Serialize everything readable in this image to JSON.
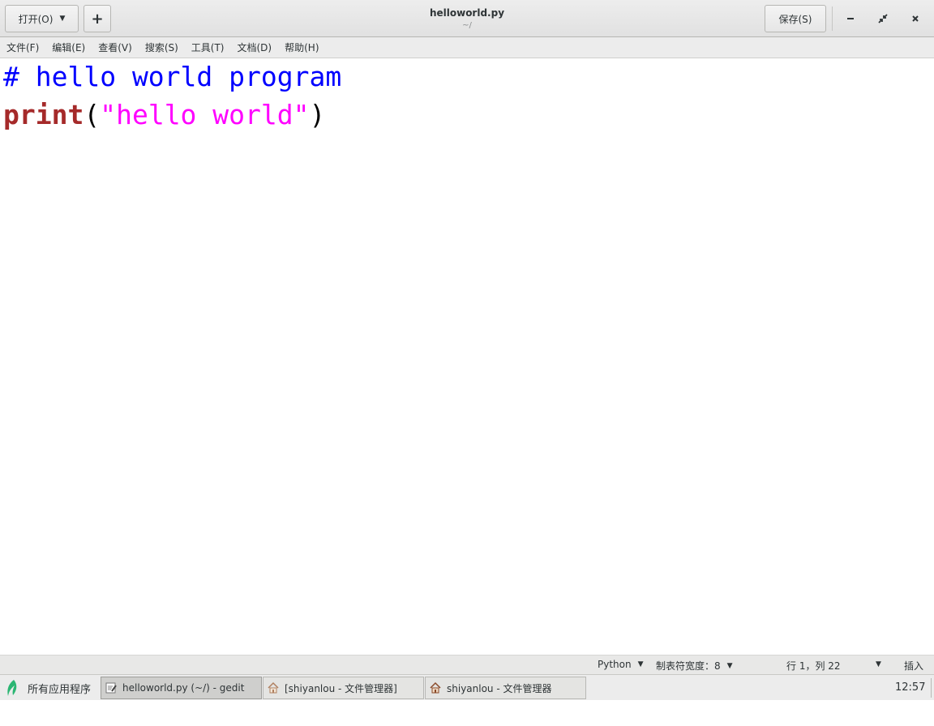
{
  "header": {
    "open_label": "打开(O)",
    "new_tab_symbol": "+",
    "title": "helloworld.py",
    "subtitle": "~/",
    "save_label": "保存(S)",
    "window_controls": [
      "minimize-icon",
      "restore-icon",
      "close-icon"
    ]
  },
  "menubar": {
    "items": [
      {
        "label": "文件(F)"
      },
      {
        "label": "编辑(E)"
      },
      {
        "label": "查看(V)"
      },
      {
        "label": "搜索(S)"
      },
      {
        "label": "工具(T)"
      },
      {
        "label": "文档(D)"
      },
      {
        "label": "帮助(H)"
      }
    ]
  },
  "editor": {
    "lines": [
      {
        "comment": "# hello world program"
      },
      {
        "builtin": "print",
        "open_paren": "(",
        "string": "\"hello world\"",
        "close_paren": ")"
      }
    ],
    "colors": {
      "comment": "#0000ff",
      "builtin": "#a52a2a",
      "string": "#ff00ff"
    }
  },
  "statusbar": {
    "language": "Python",
    "tab_width": "制表符宽度：8",
    "position": "行 1，列 22",
    "mode": "插入"
  },
  "taskbar": {
    "apps_menu_label": "所有应用程序",
    "tasks": [
      {
        "label": "helloworld.py (~/) - gedit",
        "icon": "text-editor-icon",
        "active": true
      },
      {
        "label": "[shiyanlou - 文件管理器]",
        "icon": "home-folder-icon",
        "active": false
      },
      {
        "label": "shiyanlou - 文件管理器",
        "icon": "home-folder-icon",
        "active": false
      }
    ],
    "clock": "12:57"
  }
}
